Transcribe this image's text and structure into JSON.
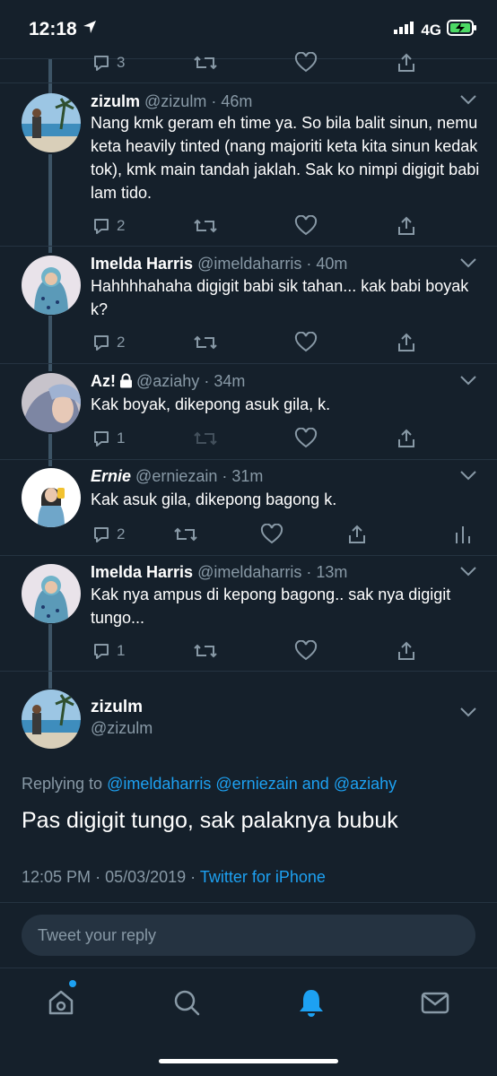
{
  "status_bar": {
    "time": "12:18",
    "network": "4G"
  },
  "colors": {
    "background": "#15202b",
    "accent": "#1da1f2",
    "muted": "#8899a6",
    "thread_line": "#3d5466"
  },
  "top_actions": {
    "reply_count": "3"
  },
  "tweets": [
    {
      "name": "zizulm",
      "handle": "@zizulm",
      "time": "46m",
      "text": "Nang kmk geram eh time ya. So bila balit sinun, nemu keta heavily tinted (nang majoriti keta kita sinun kedak tok), kmk main tandah jaklah. Sak ko nimpi digigit babi lam tido.",
      "reply_count": "2"
    },
    {
      "name": "Imelda Harris",
      "handle": "@imeldaharris",
      "time": "40m",
      "text": "Hahhhhahaha digigit babi sik tahan... kak babi boyak k?",
      "reply_count": "2"
    },
    {
      "name": "Az!",
      "handle": "@aziahy",
      "time": "34m",
      "text": "Kak boyak, dikepong asuk gila, k.",
      "reply_count": "1"
    },
    {
      "name": "Ernie",
      "handle": "@erniezain",
      "time": "31m",
      "text": "Kak asuk gila, dikepong bagong k.",
      "reply_count": "2"
    },
    {
      "name": "Imelda Harris",
      "handle": "@imeldaharris",
      "time": "13m",
      "text": "Kak nya ampus di kepong bagong.. sak nya digigit tungo...",
      "reply_count": "1"
    }
  ],
  "main_tweet": {
    "name": "zizulm",
    "handle": "@zizulm",
    "replying_prefix": "Replying to",
    "replying_1": "@imeldaharris",
    "replying_2": "@erniezain",
    "replying_and": "and",
    "replying_3": "@aziahy",
    "text": "Pas digigit tungo, sak palaknya bubuk",
    "time": "12:05 PM",
    "date": "05/03/2019",
    "source": "Twitter for iPhone"
  },
  "reply_box": {
    "placeholder": "Tweet your reply"
  },
  "tab_bar": {
    "items": [
      "home-icon",
      "search-icon",
      "notifications-icon",
      "messages-icon"
    ]
  }
}
